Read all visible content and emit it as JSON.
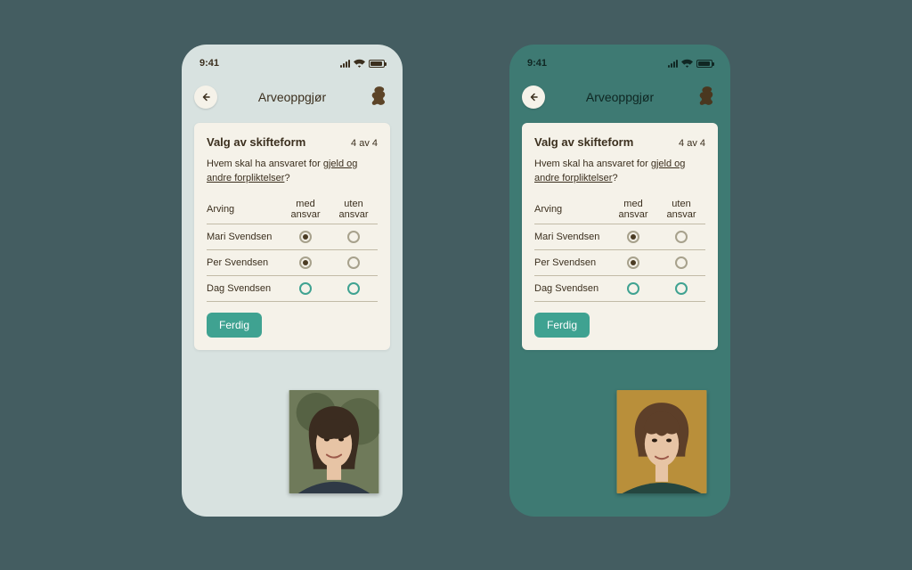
{
  "status_time": "9:41",
  "app_title": "Arveoppgjør",
  "card": {
    "heading": "Valg av skifteform",
    "step": "4 av 4",
    "prompt_pre": "Hvem skal ha ansvaret for ",
    "prompt_link": "gjeld og andre forpliktelser",
    "prompt_post": "?"
  },
  "table": {
    "col_heir": "Arving",
    "col_with": "med ansvar",
    "col_without": "uten ansvar",
    "rows": [
      {
        "name": "Mari Svendsen",
        "with": "selected",
        "without": "empty"
      },
      {
        "name": "Per Svendsen",
        "with": "selected",
        "without": "empty"
      },
      {
        "name": "Dag Svendsen",
        "with": "teal",
        "without": "teal"
      }
    ]
  },
  "done_label": "Ferdig",
  "tiles": {
    "left_alt": "portrait-woman",
    "right_alt": "portrait-man"
  }
}
